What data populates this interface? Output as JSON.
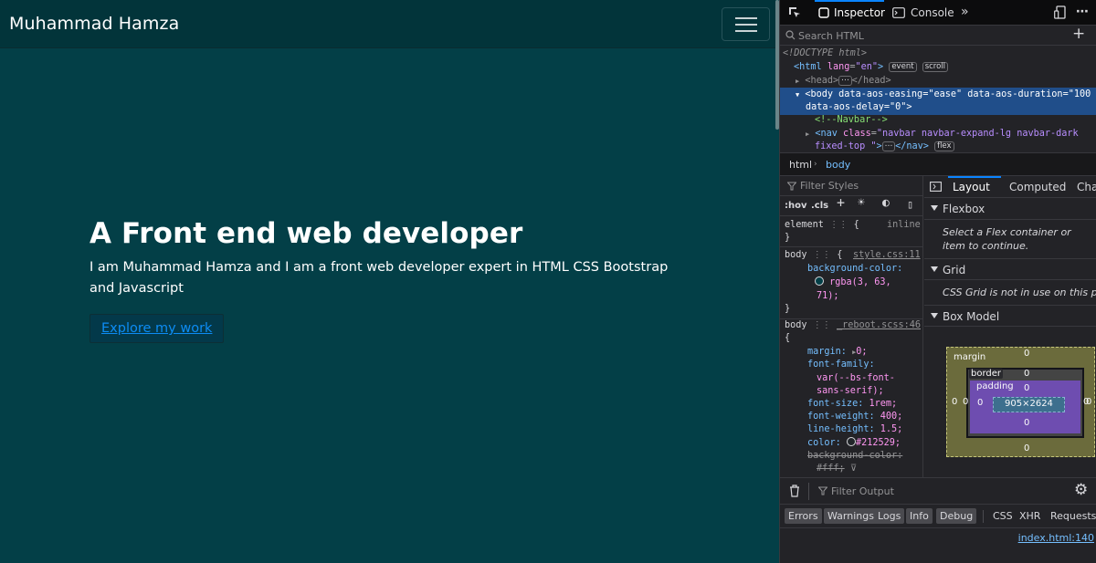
{
  "site": {
    "brand": "Muhammad Hamza",
    "hero_title": "A Front end web developer",
    "hero_text": "I am Muhammad Hamza and I am a front web developer expert in HTML CSS Bootstrap and Javascript",
    "cta_label": "Explore my work",
    "colors": {
      "background": "#033f47",
      "navbar": "#02343a",
      "link": "#0d8cf4"
    }
  },
  "devtools": {
    "tabs": {
      "inspector": "Inspector",
      "console": "Console"
    },
    "search_placeholder": "Search HTML",
    "markup": {
      "doctype": "<!DOCTYPE html>",
      "html_tag": "<html",
      "html_attr": "lang",
      "html_val": "\"en\"",
      "html_close": ">",
      "badge_event": "event",
      "badge_scroll": "scroll",
      "head": "<head>",
      "head_close": "</head>",
      "body_open": "<body",
      "body_attr1": "data-aos-easing",
      "body_val1": "\"ease\"",
      "body_attr2": "data-aos-duration",
      "body_val2": "\"100",
      "body_attr3": "data-aos-delay",
      "body_val3": "\"0\"",
      "body_close": ">",
      "comment": "<!--Navbar-->",
      "nav_open": "<nav",
      "nav_attr": "class",
      "nav_val1": "\"navbar navbar-expand-lg navbar-dark",
      "nav_val2": "fixed-top \"",
      "nav_close": "></nav>",
      "badge_flex": "flex"
    },
    "breadcrumbs": [
      "html",
      "body"
    ],
    "rules": {
      "filter_placeholder": "Filter Styles",
      "hov": ":hov",
      "cls": ".cls",
      "element_selector": "element",
      "element_source": "inline",
      "body_selector": "body",
      "source1": "style.css:11",
      "bg_prop": "background-color:",
      "bg_val1": "rgba(3, 63,",
      "bg_val2": "71);",
      "source2": "_reboot.scss:46",
      "margin_prop": "margin:",
      "margin_val": "0;",
      "ff_prop": "font-family:",
      "ff_val1": "var(--bs-font-",
      "ff_val2": "sans-serif);",
      "fs_prop": "font-size:",
      "fs_val": "1rem;",
      "fw_prop": "font-weight:",
      "fw_val": "400;",
      "lh_prop": "line-height:",
      "lh_val": "1.5;",
      "color_prop": "color:",
      "color_val": "#212529;",
      "bg2_prop": "background-color:",
      "bg2_val": "#fff;",
      "open_brace": "{",
      "close_brace": "}",
      "swatch_color": "#033f47",
      "text_swatch_color": "#212529"
    },
    "layout": {
      "tabs": [
        "Layout",
        "Computed",
        "Chan"
      ],
      "flexbox_title": "Flexbox",
      "flexbox_note": "Select a Flex container or item to continue.",
      "grid_title": "Grid",
      "grid_note": "CSS Grid is not in use on this page",
      "boxmodel_title": "Box Model",
      "boxmodel": {
        "margin_label": "margin",
        "border_label": "border",
        "padding_label": "padding",
        "content_size": "905×2624",
        "zero": "0"
      }
    },
    "console": {
      "filter_placeholder": "Filter Output",
      "buttons": [
        "Errors",
        "Warnings",
        "Logs",
        "Info",
        "Debug"
      ],
      "types": [
        "CSS",
        "XHR",
        "Requests"
      ],
      "location": "index.html:140"
    }
  }
}
